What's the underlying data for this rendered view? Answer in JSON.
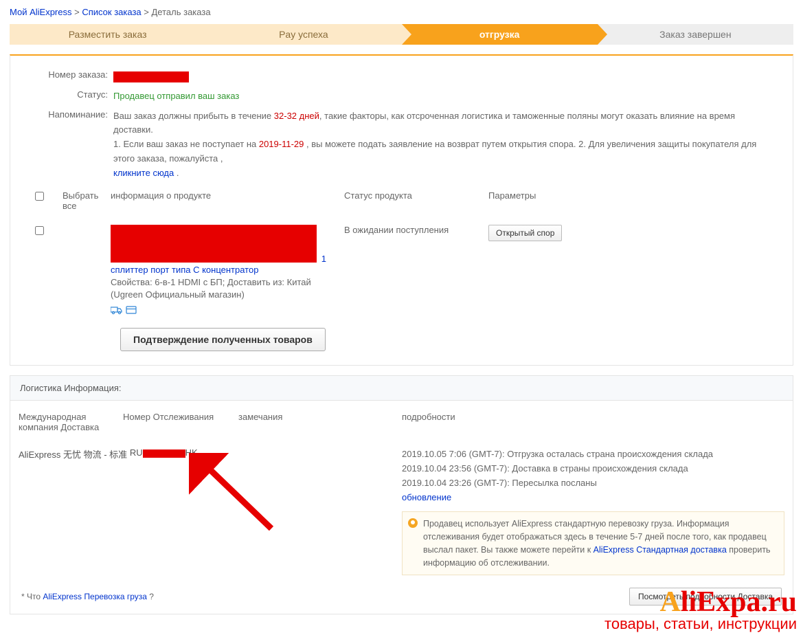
{
  "breadcrumb": {
    "my": "Мой AliExpress",
    "list": "Список заказа",
    "cur": "Деталь заказа"
  },
  "steps": {
    "place": "Разместить заказ",
    "pay": "Pay успеха",
    "ship": "отгрузка",
    "done": "Заказ завершен"
  },
  "order": {
    "num_label": "Номер заказа:",
    "status_label": "Статус:",
    "status_val": "Продавец отправил ваш заказ",
    "remind_label": "Напоминание:",
    "remind_part1": "Ваш заказ должны прибыть в течение ",
    "remind_days": "32-32 дней",
    "remind_part2": ", такие факторы, как отсроченная логистика и таможенные поляны могут оказать влияние на время доставки.",
    "remind_part3": "1. Если ваш заказ не поступает на ",
    "remind_date": "2019-11-29",
    "remind_part4": " , вы можете подать заявление на возврат путем открытия спора. 2. Для увеличения защиты покупателя для этого заказа, пожалуйста ,",
    "click_here": "кликните сюда",
    "dot": " ."
  },
  "cols": {
    "selall": "Выбрать все",
    "info": "информация о продукте",
    "status": "Статус продукта",
    "params": "Параметры"
  },
  "product": {
    "qty": "1",
    "linktxt": "сплиттер порт типа C концентратор",
    "meta1": "Свойства: 6-в-1 HDMI с БП; Доставить из: Китай",
    "meta2": "(Ugreen Официальный магазин)",
    "status": "В ожидании поступления",
    "dispute_btn": "Открытый спор"
  },
  "confirm_btn": "Подтверждение полученных товаров",
  "logistics": {
    "title": "Логистика Информация:",
    "hcompany": "Международная компания Доставка",
    "htrack": "Номер Отслеживания",
    "hremark": "замечания",
    "hdetails": "подробности",
    "company": "AliExpress 无忧 物流 - 标准",
    "track_pre": "RU",
    "track_suf": "HK",
    "ev1": "2019.10.05 7:06 (GMT-7): Отгрузка осталась страна происхождения склада",
    "ev2": "2019.10.04 23:56 (GMT-7): Доставка в страны происхождения склада",
    "ev3": "2019.10.04 23:26 (GMT-7): Пересылка посланы",
    "upd": "обновление",
    "note_a": "Продавец использует AliExpress стандартную перевозку груза. Информация отслеживания будет отображаться здесь в течение 5-7 дней после того, как продавец выслал пакет. Вы также можете перейти к ",
    "note_link": "AliExpress Стандартная доставка",
    "note_b": " проверить информацию об отслеживании."
  },
  "foot": {
    "what": "* Что ",
    "wlink": "AliExpress Перевозка груза",
    "q": " ?",
    "btn": "Посмотреть подробности Доставка"
  },
  "wm": {
    "top_a": "A",
    "top_rest": "liExpa.ru",
    "sub": "товары, статьи, инструкции"
  }
}
